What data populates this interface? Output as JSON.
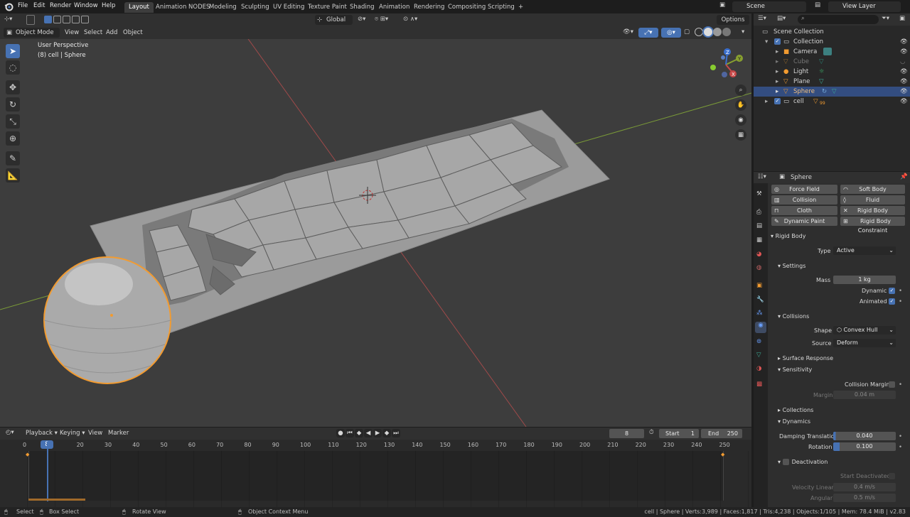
{
  "topbar": {
    "menus": [
      "File",
      "Edit",
      "Render",
      "Window",
      "Help"
    ],
    "workspaces": [
      "Layout",
      "Animation NODES",
      "Modeling",
      "Sculpting",
      "UV Editing",
      "Texture Paint",
      "Shading",
      "Animation",
      "Rendering",
      "Compositing",
      "Scripting"
    ],
    "active_workspace": "Layout",
    "plus": "+",
    "scene": "Scene",
    "view_layer": "View Layer"
  },
  "viewport_header": {
    "mode": "Object Mode",
    "menus": [
      "View",
      "Select",
      "Add",
      "Object"
    ],
    "orientation": "Global",
    "options": "Options"
  },
  "viewport": {
    "perspective": "User Perspective",
    "context": "(8) cell | Sphere",
    "gizmo": {
      "x": "X",
      "y": "Y",
      "z": "Z"
    }
  },
  "outliner": {
    "root": "Scene Collection",
    "collection": "Collection",
    "items": [
      {
        "name": "Camera",
        "dimmed": false,
        "selected": false
      },
      {
        "name": "Cube",
        "dimmed": true,
        "selected": false
      },
      {
        "name": "Light",
        "dimmed": false,
        "selected": false
      },
      {
        "name": "Plane",
        "dimmed": false,
        "selected": false
      },
      {
        "name": "Sphere",
        "dimmed": false,
        "selected": true
      },
      {
        "name": "cell",
        "dimmed": false,
        "selected": false
      }
    ],
    "cell_count": "99"
  },
  "properties": {
    "object": "Sphere",
    "physics_buttons": [
      "Force Field",
      "Soft Body",
      "Collision",
      "Fluid",
      "Cloth",
      "Rigid Body",
      "Dynamic Paint",
      "Rigid Body Constraint"
    ],
    "rigid_body": {
      "title": "Rigid Body",
      "type_label": "Type",
      "type_value": "Active"
    },
    "settings": {
      "title": "Settings",
      "mass_label": "Mass",
      "mass_value": "1 kg",
      "dynamic_label": "Dynamic",
      "animated_label": "Animated"
    },
    "collisions": {
      "title": "Collisions",
      "shape_label": "Shape",
      "shape_value": "Convex Hull",
      "source_label": "Source",
      "source_value": "Deform",
      "surface_response": "Surface Response",
      "sensitivity": "Sensitivity",
      "collision_margin": "Collision Margin",
      "margin_label": "Margin",
      "margin_value": "0.04 m"
    },
    "collections": "Collections",
    "dynamics": {
      "title": "Dynamics",
      "damping_translation_label": "Damping Translation",
      "damping_translation_value": "0.040",
      "rotation_label": "Rotation",
      "rotation_value": "0.100"
    },
    "deactivation": {
      "title": "Deactivation",
      "start_deactivated": "Start Deactivated",
      "velocity_linear_label": "Velocity Linear",
      "velocity_linear_value": "0.4 m/s",
      "angular_label": "Angular",
      "angular_value": "0.5 m/s"
    }
  },
  "timeline": {
    "menus": [
      "Playback",
      "Keying",
      "View",
      "Marker"
    ],
    "current_frame": "8",
    "start_label": "Start",
    "start_value": "1",
    "end_label": "End",
    "end_value": "250",
    "ticks": [
      "0",
      "20",
      "30",
      "40",
      "50",
      "60",
      "70",
      "80",
      "90",
      "100",
      "110",
      "120",
      "130",
      "140",
      "150",
      "160",
      "170",
      "180",
      "190",
      "200",
      "210",
      "220",
      "230",
      "240",
      "250"
    ]
  },
  "statusbar": {
    "select": "Select",
    "box_select": "Box Select",
    "rotate_view": "Rotate View",
    "context_menu": "Object Context Menu",
    "stats": "cell | Sphere | Verts:3,989 | Faces:1,817 | Tris:4,238 | Objects:1/105 | Mem: 78.4 MiB | v2.83"
  },
  "colors": {
    "accent": "#4772b3",
    "selected_outline": "#f29b30",
    "viewport_bg": "#3d3d3d",
    "x_axis": "#b34848",
    "y_axis": "#88a030"
  }
}
